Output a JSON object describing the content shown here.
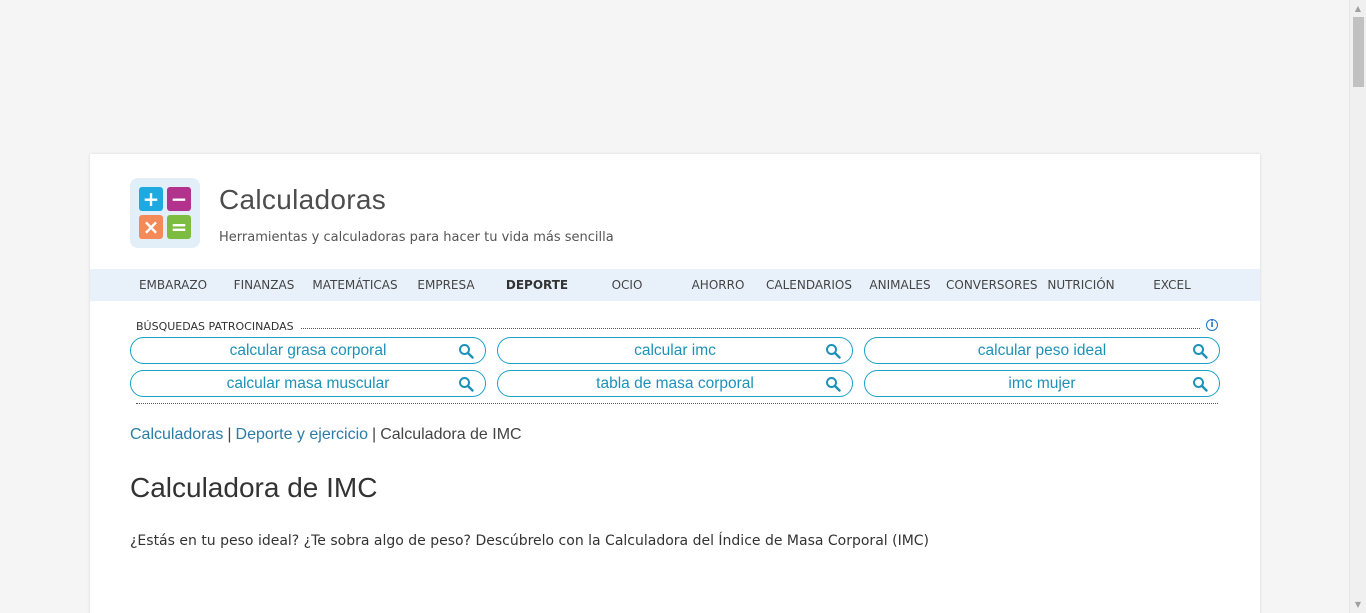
{
  "site": {
    "title": "Calculadoras",
    "subtitle": "Herramientas y calculadoras para hacer tu vida más sencilla",
    "logo_symbols": [
      "+",
      "−",
      "×",
      "="
    ],
    "colors": {
      "plus": "#1ea9e1",
      "minus": "#b1338e",
      "times": "#f48a57",
      "equal": "#7cbd3f"
    }
  },
  "nav": {
    "items": [
      "EMBARAZO",
      "FINANZAS",
      "MATEMÁTICAS",
      "EMPRESA",
      "DEPORTE",
      "OCIO",
      "AHORRO",
      "CALENDARIOS",
      "ANIMALES",
      "CONVERSORES",
      "NUTRICIÓN",
      "EXCEL"
    ],
    "active": "DEPORTE"
  },
  "sponsored": {
    "label": "BÚSQUEDAS PATROCINADAS",
    "info_icon": "info-icon",
    "searches": [
      "calcular grasa corporal",
      "calcular imc",
      "calcular peso ideal",
      "calcular masa muscular",
      "tabla de masa corporal",
      "imc mujer"
    ]
  },
  "breadcrumb": {
    "items": [
      "Calculadoras",
      "Deporte y ejercicio",
      "Calculadora de IMC"
    ],
    "separator": "|"
  },
  "page": {
    "title": "Calculadora de IMC",
    "intro": "¿Estás en tu peso ideal? ¿Te sobra algo de peso? Descúbrelo con la Calculadora del Índice de Masa Corporal (IMC)"
  }
}
